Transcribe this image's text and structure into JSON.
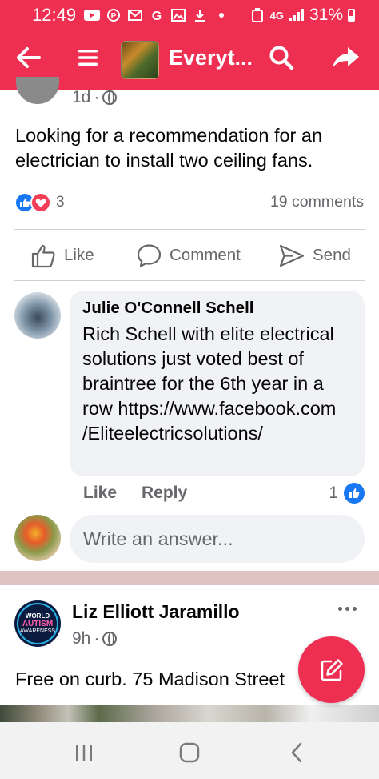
{
  "status_bar": {
    "time": "12:49",
    "network": "4G",
    "battery": "31%"
  },
  "app_bar": {
    "group_title": "Everyt..."
  },
  "post": {
    "time": "1d",
    "text": "Looking for a recommendation for an electrician to install two ceiling fans.",
    "reaction_count": "3",
    "comments_count": "19 comments",
    "actions": {
      "like": "Like",
      "comment": "Comment",
      "send": "Send"
    }
  },
  "comment": {
    "author": "Julie O'Connell Schell",
    "text": "Rich Schell with elite electrical solutions just voted best of braintree for the 6th year in a row https://www.facebook.com /Eliteelectricsolutions/",
    "like_label": "Like",
    "reply_label": "Reply",
    "reaction_count": "1"
  },
  "answer_input": {
    "placeholder": "Write an answer..."
  },
  "post2": {
    "author": "Liz Elliott Jaramillo",
    "time": "9h",
    "text": "Free on curb. 75 Madison Street",
    "avatar_text": {
      "line1": "WORLD",
      "line2": "AUTISM",
      "line3": "AWARENESS"
    }
  },
  "colors": {
    "brand": "#ee2f52",
    "like_blue": "#1877f2",
    "love_red": "#f33e58",
    "secondary_text": "#65676b"
  },
  "icons": {
    "back": "arrow-left-icon",
    "menu": "hamburger-menu-icon",
    "search": "search-icon",
    "share": "share-arrow-icon",
    "compose": "pencil-square-icon"
  }
}
